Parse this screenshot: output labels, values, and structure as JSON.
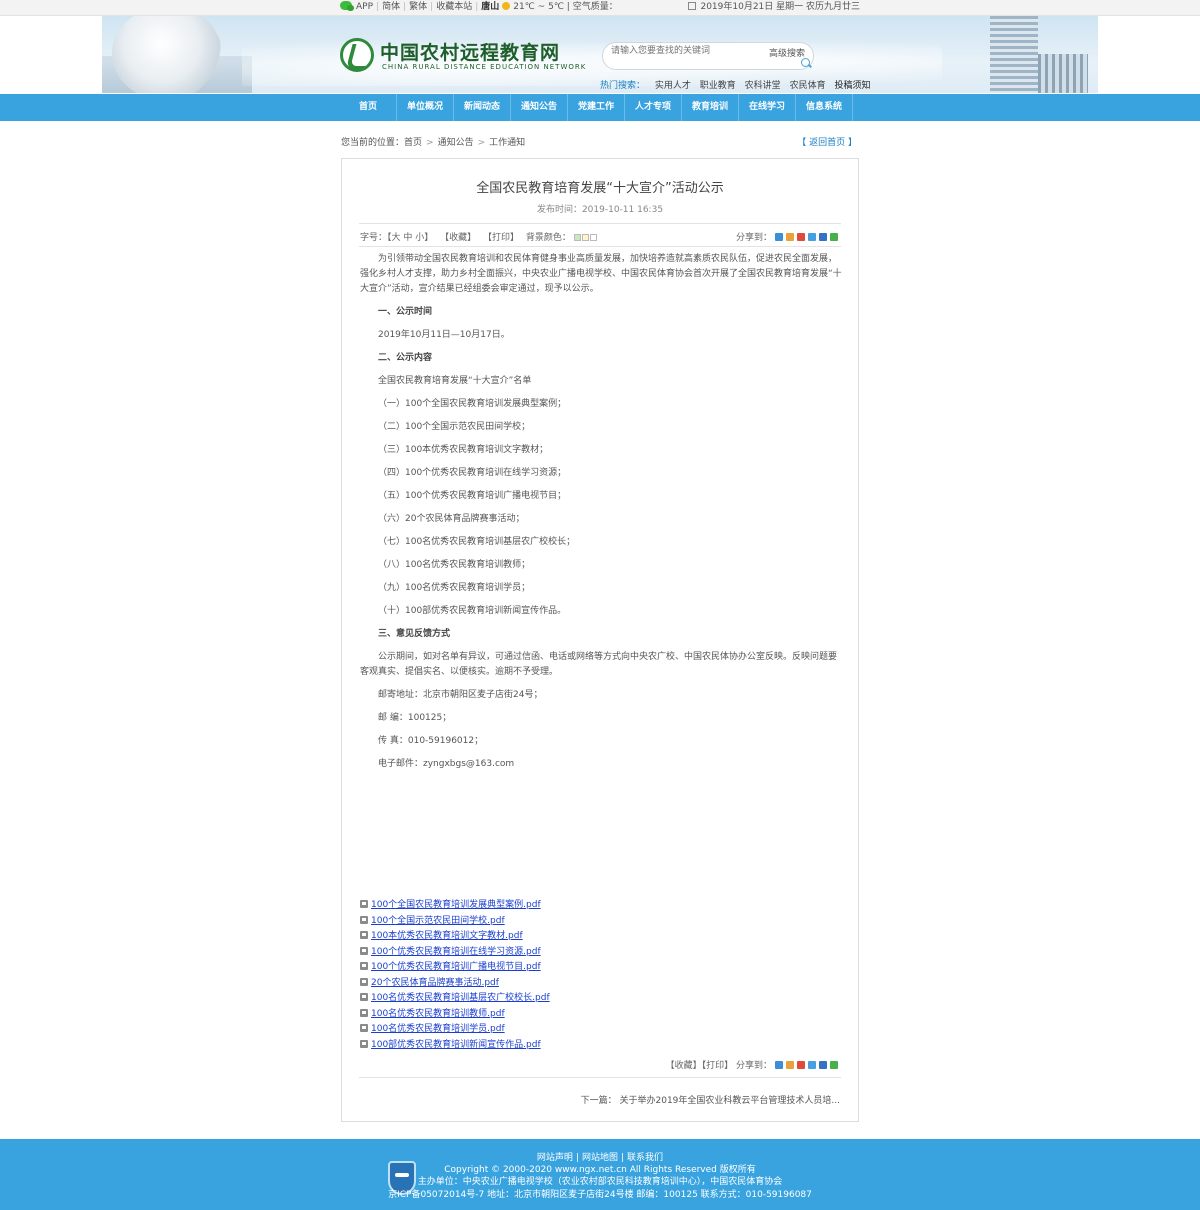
{
  "topbar": {
    "app": "APP",
    "simplified": "简体",
    "traditional": "繁体",
    "bookmark": "收藏本站",
    "city": "唐山",
    "temp": "21℃ ~ 5℃",
    "air": "| 空气质量：",
    "date": "2019年10月21日 星期一  农历九月廿三"
  },
  "header": {
    "logo_cn": "中国农村远程教育网",
    "logo_en": "CHINA RURAL DISTANCE EDUCATION NETWORK",
    "search_placeholder": "请输入您要查找的关键词",
    "advanced_search": "高级搜索",
    "hot_label": "热门搜索：",
    "hot_items": [
      "实用人才",
      "职业教育",
      "农科讲堂",
      "农民体育",
      "投稿须知"
    ]
  },
  "nav": {
    "items": [
      "首页",
      "单位概况",
      "新闻动态",
      "通知公告",
      "党建工作",
      "人才专项",
      "教育培训",
      "在线学习",
      "信息系统"
    ]
  },
  "breadcrumb": {
    "prefix": "您当前的位置：",
    "items": [
      "首页",
      "通知公告",
      "工作通知"
    ],
    "back": "【 返回首页 】"
  },
  "article": {
    "title": "全国农民教育培育发展“十大宣介”活动公示",
    "date": "发布时间：2019-10-11 16:35",
    "tools": {
      "font_size": "字号：【大 中 小】",
      "favorite": "【收藏】",
      "print": "【打印】",
      "bg_color": "背景颜色："
    },
    "share_label": "分享到：",
    "swatch_colors": [
      "#c9e8c2",
      "#fff6c8",
      "#ffffff"
    ],
    "share_colors": [
      "#3c8fd6",
      "#e8a23a",
      "#e04a3a",
      "#46a0e0",
      "#3672c4",
      "#48b048"
    ],
    "intro": "为引领带动全国农民教育培训和农民体育健身事业高质量发展，加快培养造就高素质农民队伍，促进农民全面发展，强化乡村人才支撑，助力乡村全面振兴，中央农业广播电视学校、中国农民体育协会首次开展了全国农民教育培育发展“十大宣介”活动，宣介结果已经组委会审定通过，现予以公示。",
    "h1": "一、公示时间",
    "period": "2019年10月11日—10月17日。",
    "h2": "二、公示内容",
    "list_title": "全国农民教育培育发展“十大宣介”名单",
    "items": [
      "（一）100个全国农民教育培训发展典型案例；",
      "（二）100个全国示范农民田间学校；",
      "（三）100本优秀农民教育培训文字教材；",
      "（四）100个优秀农民教育培训在线学习资源；",
      "（五）100个优秀农民教育培训广播电视节目；",
      "（六）20个农民体育品牌赛事活动；",
      "（七）100名优秀农民教育培训基层农广校校长；",
      "（八）100名优秀农民教育培训教师；",
      "（九）100名优秀农民教育培训学员；",
      "（十）100部优秀农民教育培训新闻宣传作品。"
    ],
    "h3": "三、意见反馈方式",
    "feedback": "公示期间，如对名单有异议，可通过信函、电话或网络等方式向中央农广校、中国农民体协办公室反映。反映问题要客观真实、提倡实名、以便核实。逾期不予受理。",
    "address": "邮寄地址：北京市朝阳区麦子店街24号；",
    "postcode": "邮 编：100125；",
    "fax": "传 真：010-59196012；",
    "email": "电子邮件：zyngxbgs@163.com",
    "attachments": [
      "100个全国农民教育培训发展典型案例.pdf",
      "100个全国示范农民田间学校.pdf",
      "100本优秀农民教育培训文字教材.pdf",
      "100个优秀农民教育培训在线学习资源.pdf",
      "100个优秀农民教育培训广播电视节目.pdf",
      "20个农民体育品牌赛事活动.pdf",
      "100名优秀农民教育培训基层农广校校长.pdf",
      "100名优秀农民教育培训教师.pdf",
      "100名优秀农民教育培训学员.pdf",
      "100部优秀农民教育培训新闻宣传作品.pdf"
    ],
    "bottom_favorite": "【收藏】",
    "bottom_print": "【打印】",
    "next": "下一篇：  关于举办2019年全国农业科教云平台管理技术人员培..."
  },
  "footer": {
    "links": [
      "网站声明",
      "网站地图",
      "联系我们"
    ],
    "copyright": "Copyright © 2000-2020    www.ngx.net.cn    All Rights Reserved    版权所有",
    "organizer": "主办单位：中央农业广播电视学校（农业农村部农民科技教育培训中心），中国农民体育协会",
    "icp": "京ICP备05072014号-7    地址：北京市朝阳区麦子店街24号楼    邮编：100125    联系方式：010-59196087"
  }
}
